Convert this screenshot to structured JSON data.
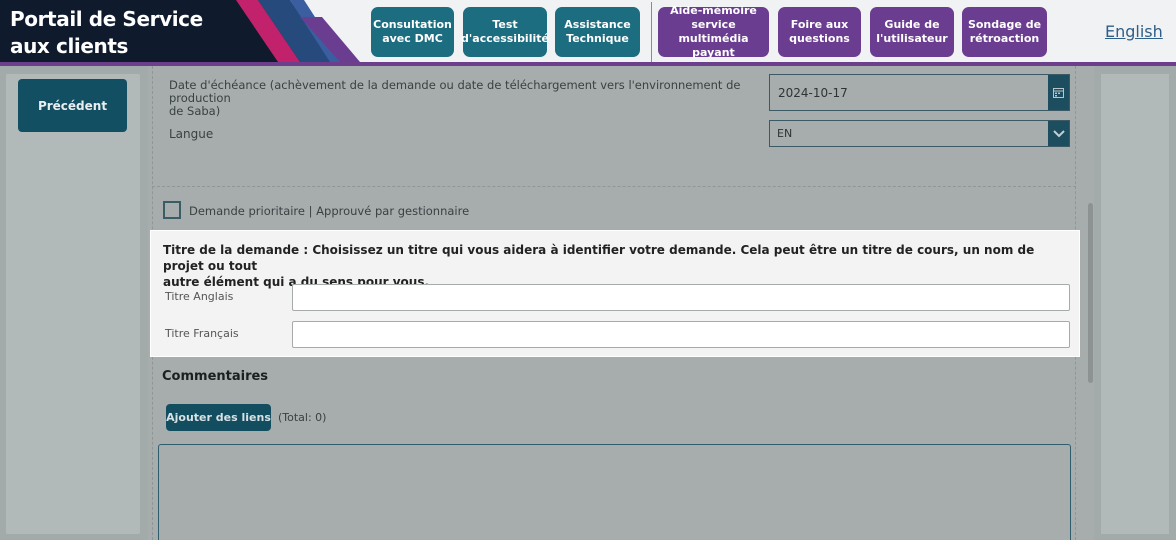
{
  "header": {
    "brand_line1": "Portail de Service",
    "brand_line2": "aux clients",
    "nav": [
      {
        "label_line1": "Consultation",
        "label_line2": "avec DMC",
        "label_line3": ""
      },
      {
        "label_line1": "Test",
        "label_line2": "d'accessibilité",
        "label_line3": ""
      },
      {
        "label_line1": "Assistance",
        "label_line2": "Technique",
        "label_line3": ""
      },
      {
        "label_line1": "Aide-mémoire",
        "label_line2": "service multimédia",
        "label_line3": "payant"
      },
      {
        "label_line1": "Foire aux",
        "label_line2": "questions",
        "label_line3": ""
      },
      {
        "label_line1": "Guide de",
        "label_line2": "l'utilisateur",
        "label_line3": ""
      },
      {
        "label_line1": "Sondage de",
        "label_line2": "rétroaction",
        "label_line3": ""
      }
    ],
    "language_link": "English",
    "colors": {
      "teal": "#1d6d80",
      "purple": "#6b3d91",
      "brand_dark": "#0f1a2c"
    }
  },
  "sidebar": {
    "previous_label": "Précédent"
  },
  "form": {
    "due_date_label_line1": "Date d'échéance (achèvement de la demande ou date de téléchargement vers l'environnement de production",
    "due_date_label_line2": "de Saba)",
    "due_date_value": "2024-10-17",
    "language_label": "Langue",
    "language_value": "EN",
    "priority_label": "Demande prioritaire | Approuvé par gestionnaire",
    "title_section_line1": "Titre de la demande : Choisissez un titre qui vous aidera à identifier votre demande. Cela peut être un titre de cours, un nom de projet ou tout",
    "title_section_line2": "autre élément qui a du sens pour vous.",
    "english_title_label": "Titre Anglais",
    "english_title_value": "",
    "french_title_label": "Titre Français",
    "french_title_value": "",
    "comments_title": "Commentaires",
    "add_links_label": "Ajouter des liens",
    "total_label": "(Total: 0)"
  }
}
